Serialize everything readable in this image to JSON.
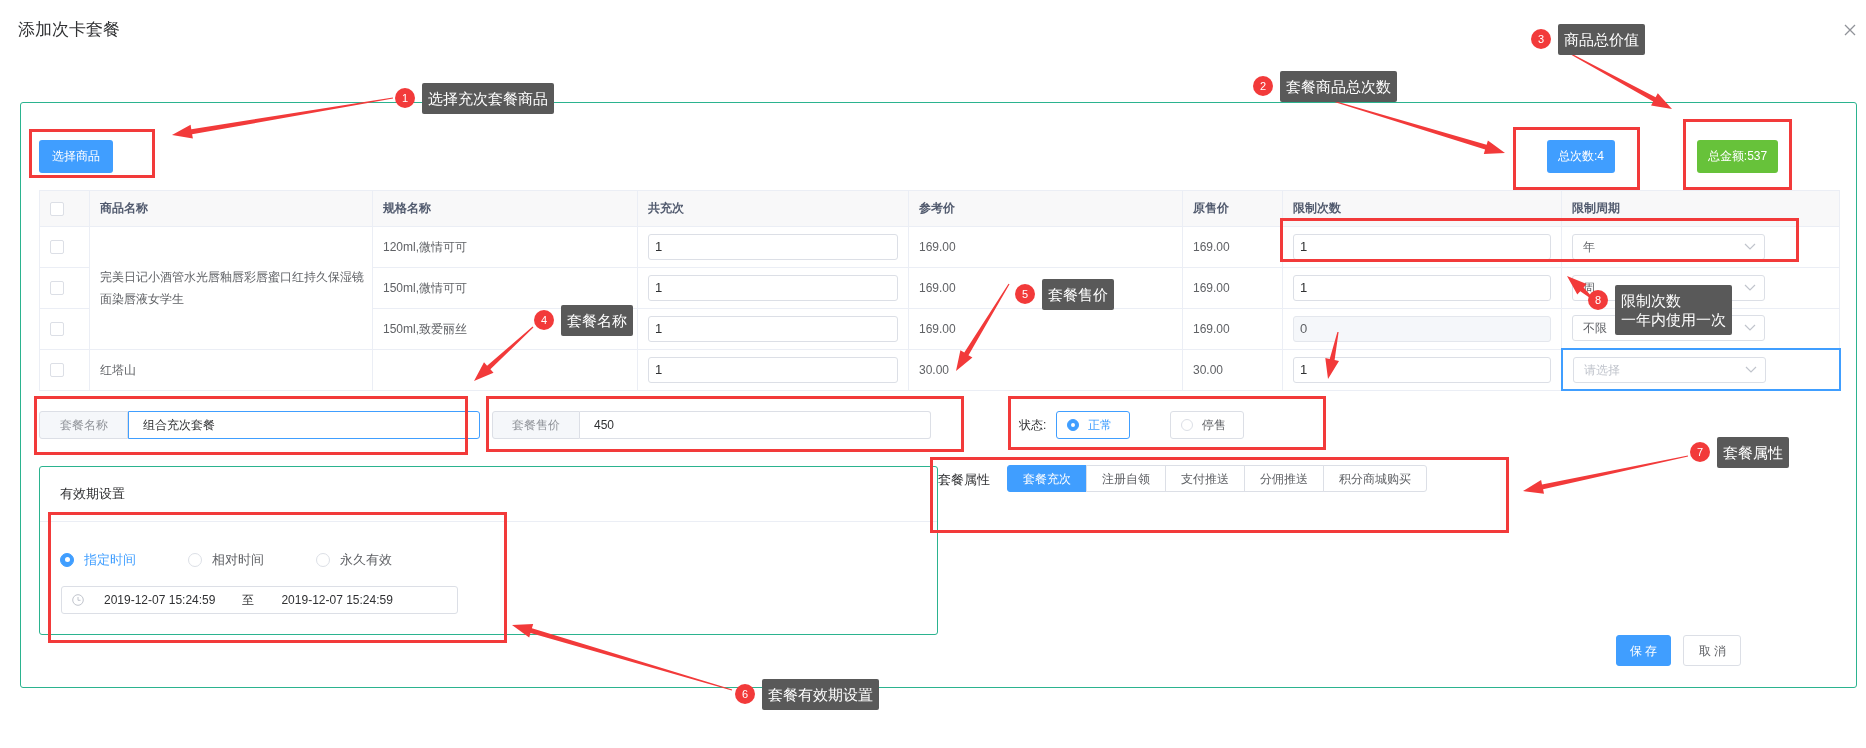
{
  "dialog": {
    "title": "添加次卡套餐"
  },
  "toolbar": {
    "select_button": "选择商品",
    "total_count": "总次数:4",
    "total_amount": "总金额:537"
  },
  "table": {
    "header_checked": false,
    "columns": [
      "商品名称",
      "规格名称",
      "共充次",
      "参考价",
      "原售价",
      "限制次数",
      "限制周期"
    ],
    "products": [
      {
        "name": "完美日记小酒管水光唇釉唇彩唇蜜口红持久保湿镜面染唇液女学生",
        "skus": [
          {
            "spec": "120ml,微情可可",
            "checked": false,
            "count": "1",
            "ref_price": "169.00",
            "orig_price": "169.00",
            "limit": {
              "value": "1",
              "disabled": false
            },
            "period": {
              "value": "年",
              "focused": false
            }
          },
          {
            "spec": "150ml,微情可可",
            "checked": false,
            "count": "1",
            "ref_price": "169.00",
            "orig_price": "169.00",
            "limit": {
              "value": "1",
              "disabled": false
            },
            "period": {
              "value": "周",
              "focused": false
            }
          },
          {
            "spec": "150ml,致爱丽丝",
            "checked": false,
            "count": "1",
            "ref_price": "169.00",
            "orig_price": "169.00",
            "limit": {
              "value": "0",
              "disabled": true
            },
            "period": {
              "value": "不限",
              "focused": false
            }
          }
        ]
      },
      {
        "name": "红塔山",
        "skus": [
          {
            "checked": false,
            "count": "1",
            "ref_price": "30.00",
            "orig_price": "30.00",
            "limit": {
              "value": "1",
              "disabled": false
            },
            "period": {
              "placeholder": "请选择",
              "focused": true
            }
          }
        ]
      }
    ]
  },
  "form": {
    "name": {
      "label": "套餐名称",
      "value": "组合充次套餐",
      "focused": true
    },
    "price": {
      "label": "套餐售价",
      "value": "450",
      "focused": false
    },
    "status": {
      "label": "状态:",
      "options": [
        {
          "label": "正常",
          "selected": true
        },
        {
          "label": "停售",
          "selected": false
        }
      ]
    }
  },
  "validity": {
    "title": "有效期设置",
    "modes": [
      {
        "label": "指定时间",
        "selected": true
      },
      {
        "label": "相对时间",
        "selected": false
      },
      {
        "label": "永久有效",
        "selected": false
      }
    ],
    "range": {
      "start": "2019-12-07 15:24:59",
      "separator": "至",
      "end": "2019-12-07 15:24:59"
    }
  },
  "attributes": {
    "label": "套餐属性",
    "options": [
      {
        "label": "套餐充次",
        "selected": true
      },
      {
        "label": "注册自领",
        "selected": false
      },
      {
        "label": "支付推送",
        "selected": false
      },
      {
        "label": "分佣推送",
        "selected": false
      },
      {
        "label": "积分商城购买",
        "selected": false
      }
    ]
  },
  "buttons": [
    {
      "label": "保存",
      "kind": "primary"
    },
    {
      "label": "取消",
      "kind": "default"
    }
  ],
  "annotations": [
    {
      "number": "1",
      "lines": [
        "选择充次套餐商品"
      ]
    },
    {
      "number": "2",
      "lines": [
        "套餐商品总次数"
      ]
    },
    {
      "number": "3",
      "lines": [
        "商品总价值"
      ]
    },
    {
      "number": "4",
      "lines": [
        "套餐名称"
      ]
    },
    {
      "number": "5",
      "lines": [
        "套餐售价"
      ]
    },
    {
      "number": "6",
      "lines": [
        "套餐有效期设置"
      ]
    },
    {
      "number": "7",
      "lines": [
        "套餐属性"
      ]
    },
    {
      "number": "8",
      "lines": [
        "限制次数",
        "一年内使用一次"
      ]
    }
  ]
}
